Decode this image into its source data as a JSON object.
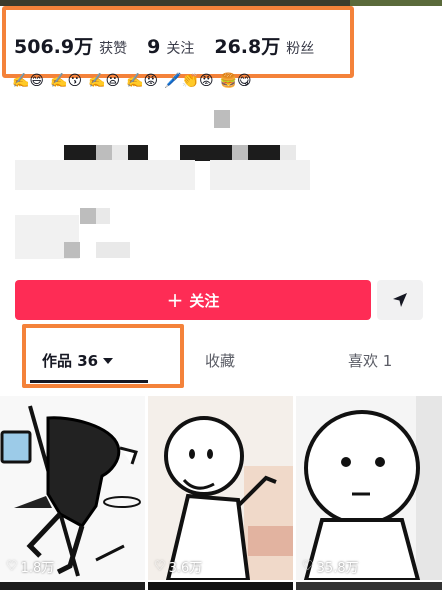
{
  "stats": [
    {
      "value": "506.9万",
      "label": "获赞"
    },
    {
      "value": "9",
      "label": "关注"
    },
    {
      "value": "26.8万",
      "label": "粉丝"
    }
  ],
  "bio_emojis": [
    "✍️😄",
    "✍️😗",
    "✍️😦",
    "✍️😡",
    "🖊️👏😡",
    "🍔😋"
  ],
  "actions": {
    "follow_label": "关注",
    "follow_icon": "plus-icon",
    "share_icon": "send-icon",
    "accent": "#fe2c55"
  },
  "tabs": [
    {
      "label": "作品 36",
      "active": true
    },
    {
      "label": "收藏",
      "active": false
    },
    {
      "label": "喜欢 1",
      "active": false
    }
  ],
  "videos": [
    {
      "likes": "1.8万"
    },
    {
      "likes": "3.6万"
    },
    {
      "likes": "35.8万"
    }
  ],
  "highlight_color": "#f4823a"
}
